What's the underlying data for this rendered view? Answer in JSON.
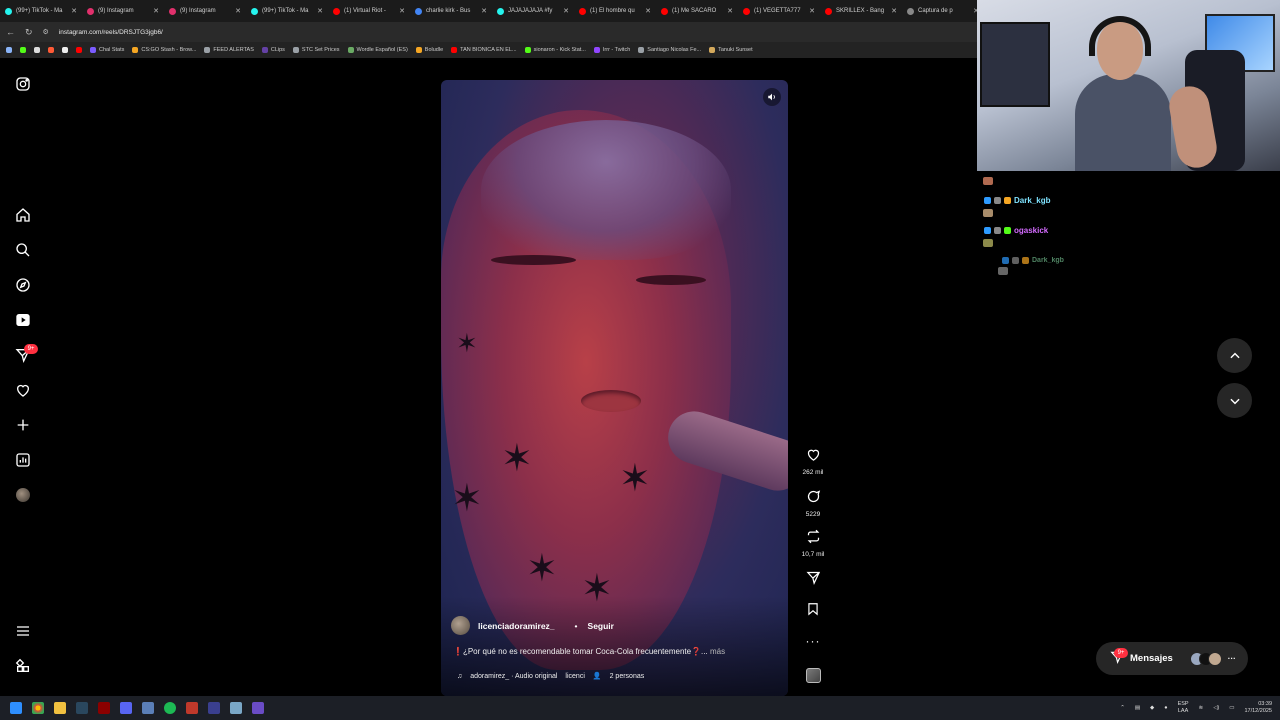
{
  "browser": {
    "tabs": [
      {
        "label": "(99+) TikTok - Ma",
        "color": "#25f4ee"
      },
      {
        "label": "(9) Instagram",
        "color": "#e1306c"
      },
      {
        "label": "(9) Instagram",
        "color": "#e1306c"
      },
      {
        "label": "(99+) TikTok - Ma",
        "color": "#25f4ee"
      },
      {
        "label": "(1) Virtual Riot -",
        "color": "#ff0000"
      },
      {
        "label": "charlie kirk - Bus",
        "color": "#4285f4"
      },
      {
        "label": "JAJAJAJAJA #fy",
        "color": "#25f4ee"
      },
      {
        "label": "(1) El hombre qu",
        "color": "#ff0000"
      },
      {
        "label": "(1) Me SACARO",
        "color": "#ff0000"
      },
      {
        "label": "(1) VEGETTA777",
        "color": "#ff0000"
      },
      {
        "label": "SKRILLEX - Bang",
        "color": "#ff0000"
      },
      {
        "label": "Captura de p",
        "color": "#888888"
      }
    ],
    "url": "instagram.com/reels/DRSJTG3jgb6/",
    "bookmarks": [
      {
        "label": "Chal Stats",
        "color": "#7b5cff"
      },
      {
        "label": "CS:GO Stash - Brow...",
        "color": "#f5a623"
      },
      {
        "label": "FEED ALERTAS",
        "color": "#9aa0a6"
      },
      {
        "label": "CLips",
        "color": "#6441a5"
      },
      {
        "label": "STC Set Prices",
        "color": "#9aa0a6"
      },
      {
        "label": "Wordle Español (ES)",
        "color": "#6aaa64"
      },
      {
        "label": "Boludle",
        "color": "#f5a623"
      },
      {
        "label": "TAN BIONICA EN EL...",
        "color": "#ff0000"
      },
      {
        "label": "sionaron - Kick Stat...",
        "color": "#53fc18"
      },
      {
        "label": "Irrr - Twitch",
        "color": "#9146ff"
      },
      {
        "label": "Santiago Nicolas Fe...",
        "color": "#9aa0a6"
      },
      {
        "label": "Tanuki Sunset",
        "color": "#d4a95c"
      }
    ]
  },
  "sidebar": {
    "items": [
      {
        "name": "instagram-logo-icon",
        "label": "Instagram"
      },
      {
        "name": "home-icon",
        "label": "Inicio"
      },
      {
        "name": "search-icon",
        "label": "Buscar"
      },
      {
        "name": "explore-icon",
        "label": "Explorar"
      },
      {
        "name": "reels-icon",
        "label": "Reels"
      },
      {
        "name": "messages-icon",
        "label": "Mensajes"
      },
      {
        "name": "notifications-icon",
        "label": "Notificaciones"
      },
      {
        "name": "create-icon",
        "label": "Crear"
      },
      {
        "name": "dashboard-icon",
        "label": "Panel"
      },
      {
        "name": "profile-avatar",
        "label": "Perfil"
      },
      {
        "name": "menu-icon",
        "label": "Más"
      },
      {
        "name": "meta-apps-icon",
        "label": "Apps"
      }
    ],
    "messages_badge": "9+"
  },
  "reel": {
    "author": "licenciadoramirez_",
    "follow_label": "Seguir",
    "caption": "❗¿Por qué no es recomendable tomar Coca-Cola frecuentemente❓...",
    "more_label": "más",
    "audio": "adoramirez_ · Audio original",
    "audio_tail": "licenci",
    "people": "2 personas",
    "likes": "262 mil",
    "comments": "5229",
    "reposts": "10,7 mil"
  },
  "chat": {
    "messages": [
      {
        "user": "Dark_kgb",
        "color": "#7fe3ff"
      },
      {
        "user": "ogaskick",
        "color": "#d46bff"
      },
      {
        "user": "Dark_kgb",
        "color": "#6fb88a"
      }
    ]
  },
  "messages_pill": {
    "label": "Mensajes",
    "badge": "9+"
  },
  "taskbar": {
    "lang_top": "ESP",
    "lang_bottom": "LAA",
    "time": "03:39",
    "date": "17/12/2025"
  }
}
